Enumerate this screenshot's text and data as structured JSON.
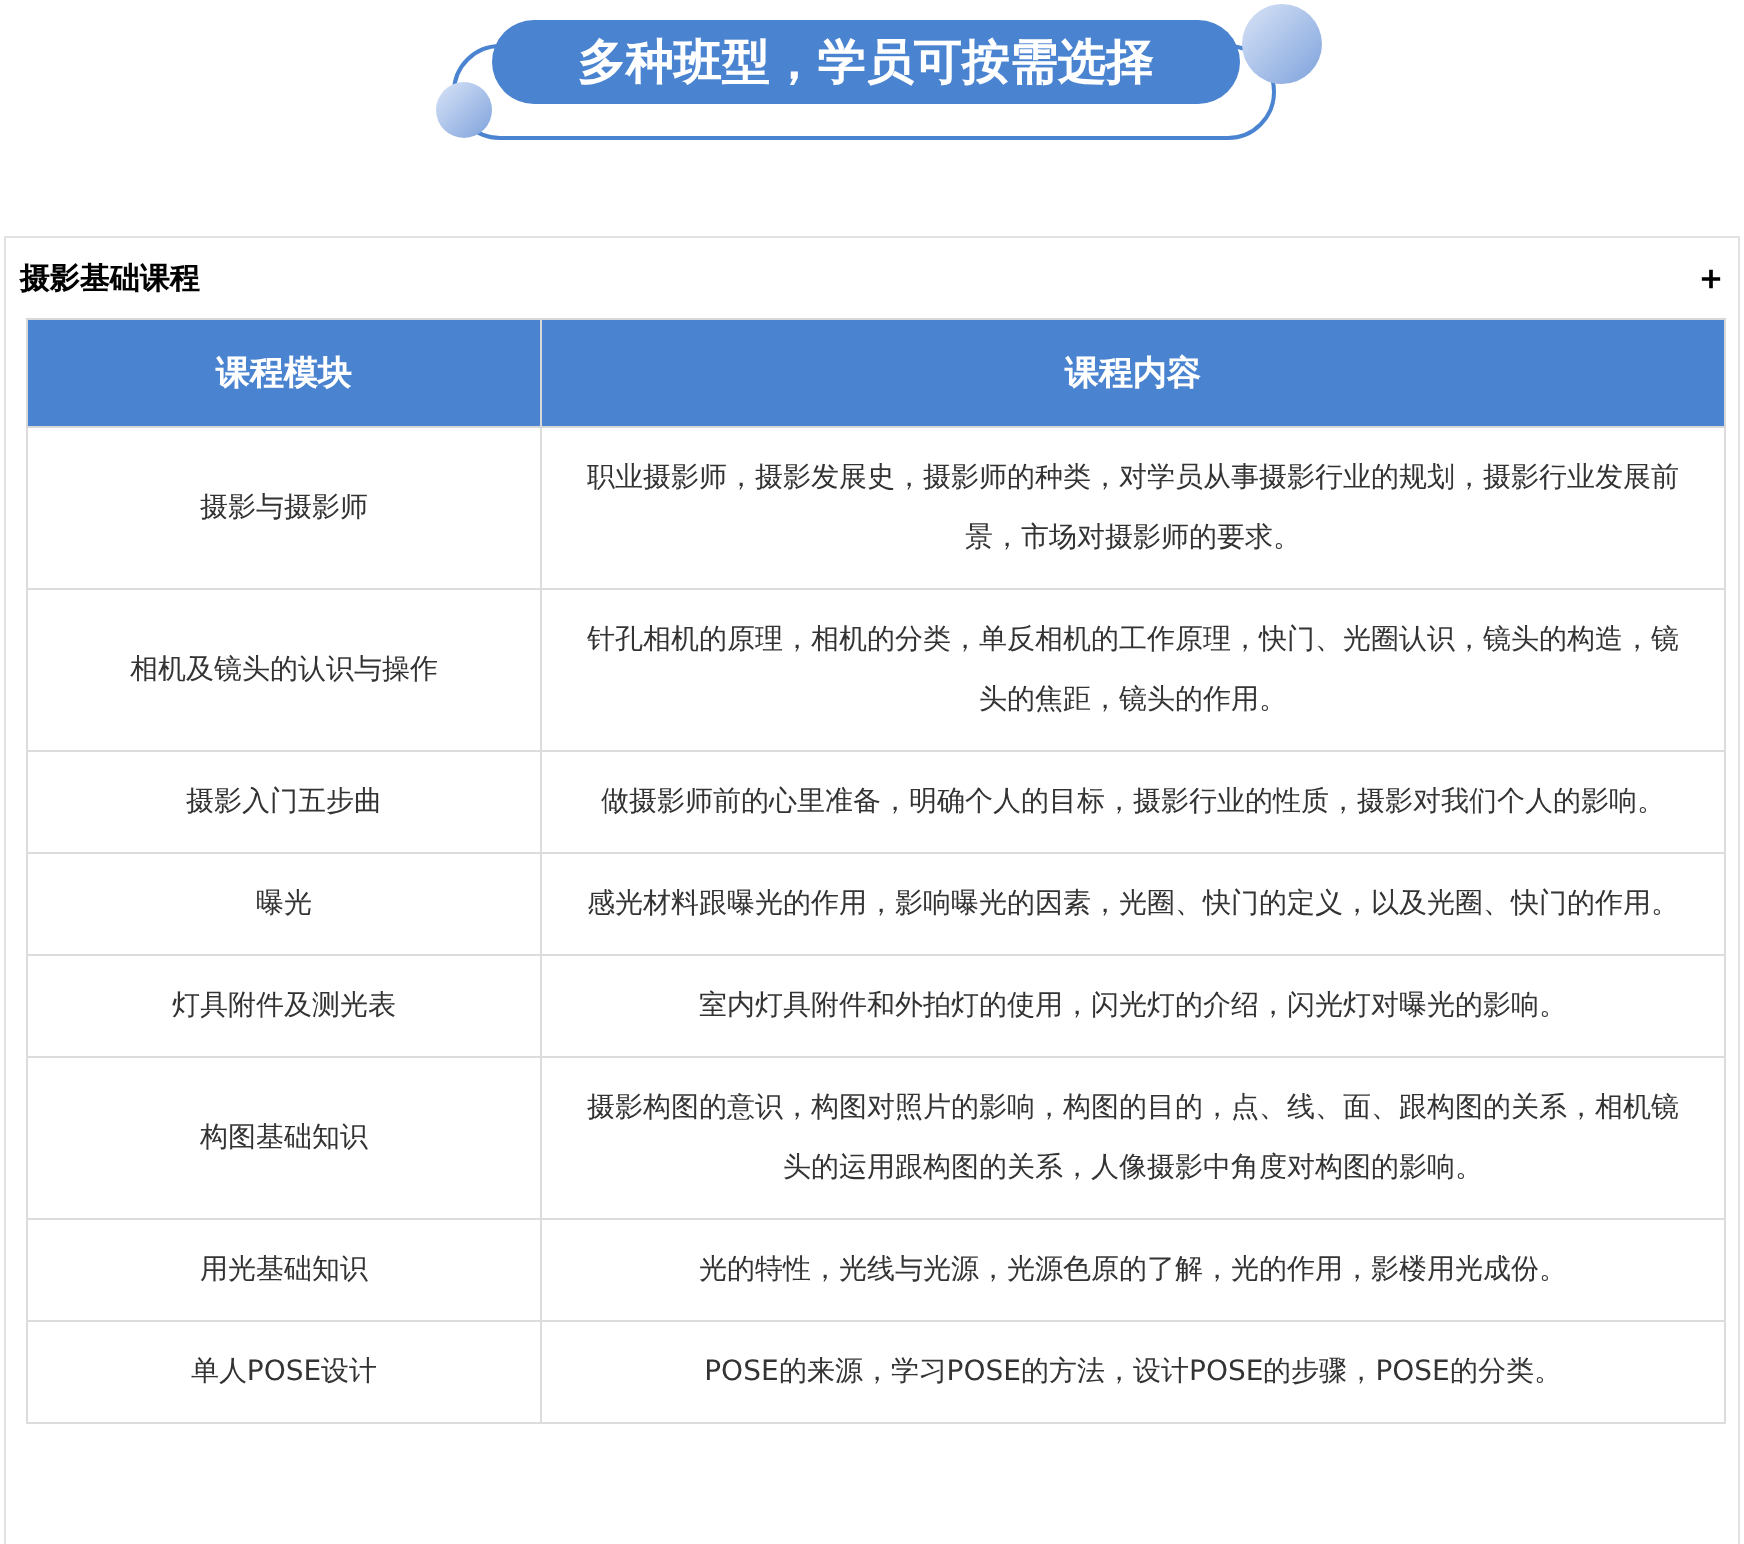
{
  "banner": {
    "title": "多种班型，学员可按需选择"
  },
  "section": {
    "title": "摄影基础课程",
    "expanded": false,
    "table": {
      "columns": [
        "课程模块",
        "课程内容"
      ],
      "rows": [
        {
          "module": "摄影与摄影师",
          "content": "职业摄影师，摄影发展史，摄影师的种类，对学员从事摄影行业的规划，摄影行业发展前景，市场对摄影师的要求。"
        },
        {
          "module": "相机及镜头的认识与操作",
          "content": "针孔相机的原理，相机的分类，单反相机的工作原理，快门、光圈认识，镜头的构造，镜头的焦距，镜头的作用。"
        },
        {
          "module": "摄影入门五步曲",
          "content": "做摄影师前的心里准备，明确个人的目标，摄影行业的性质，摄影对我们个人的影响。"
        },
        {
          "module": "曝光",
          "content": "感光材料跟曝光的作用，影响曝光的因素，光圈、快门的定义，以及光圈、快门的作用。"
        },
        {
          "module": "灯具附件及测光表",
          "content": "室内灯具附件和外拍灯的使用，闪光灯的介绍，闪光灯对曝光的影响。"
        },
        {
          "module": "构图基础知识",
          "content": "摄影构图的意识，构图对照片的影响，构图的目的，点、线、面、跟构图的关系，相机镜头的运用跟构图的关系，人像摄影中角度对构图的影响。"
        },
        {
          "module": "用光基础知识",
          "content": "光的特性，光线与光源，光源色原的了解，光的作用，影楼用光成份。"
        },
        {
          "module": "单人POSE设计",
          "content": "POSE的来源，学习POSE的方法，设计POSE的步骤，POSE的分类。"
        }
      ]
    }
  }
}
